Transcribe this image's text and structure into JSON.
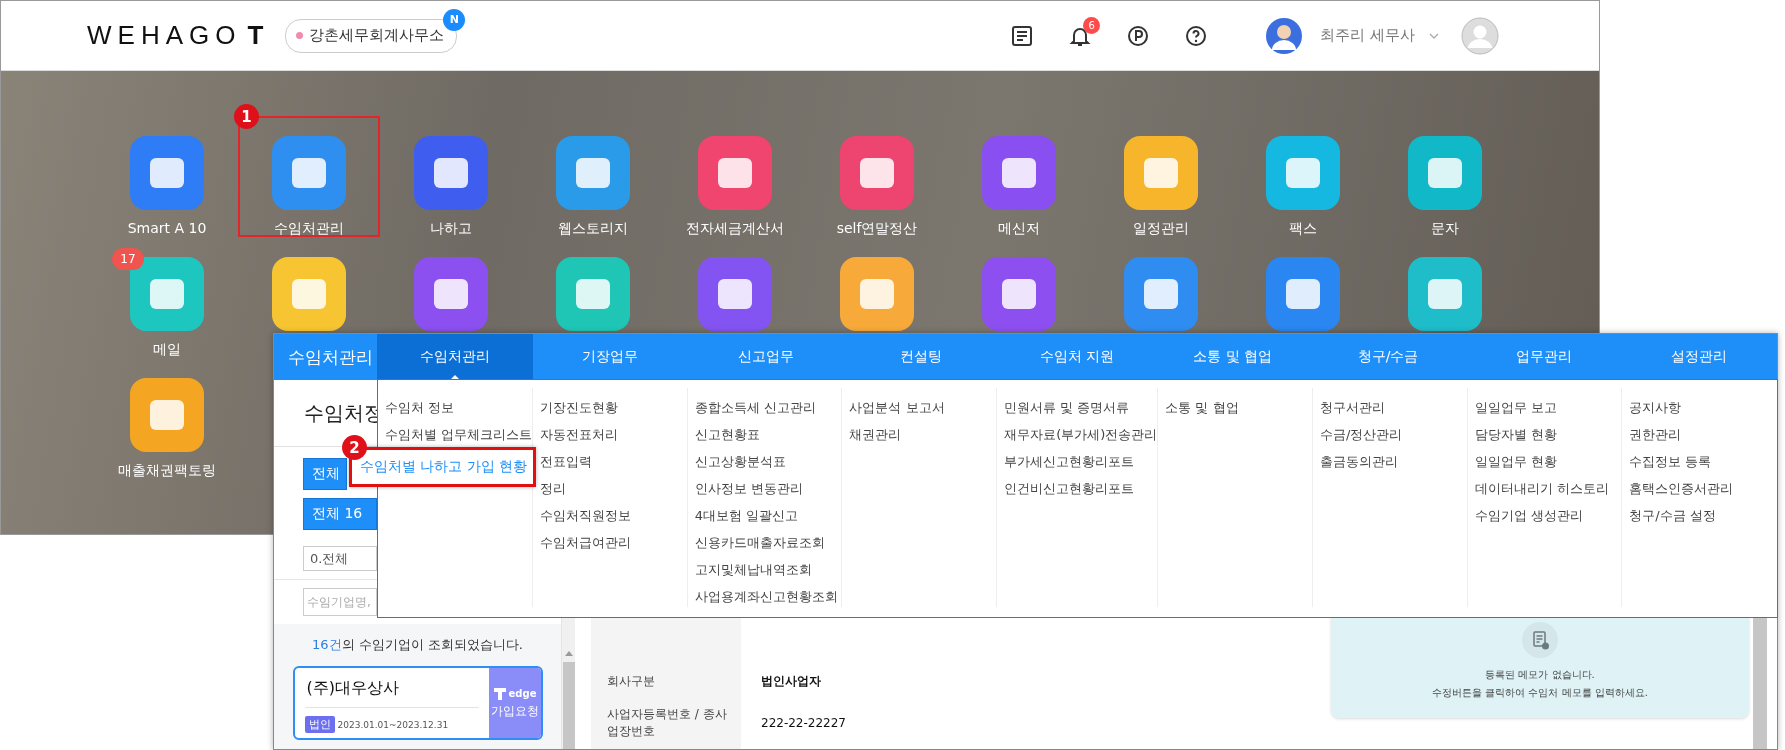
{
  "topbar": {
    "logo": "WEHAGO",
    "logo_suffix": "T",
    "company": {
      "name": "강촌세무회계사무소",
      "badge": "N"
    },
    "notification_badge": "6",
    "user_name": "최주리 세무사"
  },
  "apps": [
    {
      "label": "Smart A 10",
      "color": "#2f7df6"
    },
    {
      "label": "수임처관리",
      "color": "#2e8ff0",
      "highlighted": true,
      "callout": "1"
    },
    {
      "label": "나하고",
      "color": "#3f5ef0"
    },
    {
      "label": "웹스토리지",
      "color": "#2a9be8"
    },
    {
      "label": "전자세금계산서",
      "color": "#f0456e"
    },
    {
      "label": "self연말정산",
      "color": "#ee4470"
    },
    {
      "label": "메신저",
      "color": "#8a4ff0"
    },
    {
      "label": "일정관리",
      "color": "#f7b52c"
    },
    {
      "label": "팩스",
      "color": "#14b8e0"
    },
    {
      "label": "문자",
      "color": "#10b8c8"
    },
    {
      "label": "메일",
      "color": "#1ec6c0",
      "badge": "17"
    },
    {
      "color": "#f7c531"
    },
    {
      "color": "#8c4ff0"
    },
    {
      "color": "#1fc6b5"
    },
    {
      "color": "#8454f2"
    },
    {
      "color": "#f7a93a"
    },
    {
      "color": "#8e4ff0"
    },
    {
      "color": "#2f8df2"
    },
    {
      "color": "#2a86f0"
    },
    {
      "color": "#1fbcc9"
    },
    {
      "label": "매출채권팩토링",
      "color": "#f4a623"
    }
  ],
  "window": {
    "title": "수임처관리",
    "tabs": [
      {
        "label": "수임처관리",
        "selected": true,
        "items": [
          "수임처 정보",
          "수임처별 업무체크리스트"
        ]
      },
      {
        "label": "기장업무",
        "selected": false,
        "items": [
          "기장진도현황",
          "자동전표처리",
          "전표입력",
          "정리",
          "수임처직원정보",
          "수임처급여관리"
        ]
      },
      {
        "label": "신고업무",
        "selected": false,
        "items": [
          "종합소득세 신고관리",
          "신고현황표",
          "신고상황분석표",
          "인사정보 변동관리",
          "4대보험 일괄신고",
          "신용카드매출자료조회",
          "고지및체납내역조회",
          "사업용계좌신고현황조회"
        ]
      },
      {
        "label": "컨설팅",
        "selected": false,
        "items": [
          "사업분석 보고서",
          "채권관리"
        ]
      },
      {
        "label": "수임처 지원",
        "selected": false,
        "items": [
          "민원서류 및 증명서류",
          "재무자료(부가세)전송관리",
          "부가세신고현황리포트",
          "인건비신고현황리포트"
        ]
      },
      {
        "label": "소통 및 협업",
        "selected": false,
        "items": [
          "소통 및 협업"
        ]
      },
      {
        "label": "청구/수금",
        "selected": false,
        "items": [
          "청구서관리",
          "수금/정산관리",
          "출금동의관리"
        ]
      },
      {
        "label": "업무관리",
        "selected": false,
        "items": [
          "일일업무 보고",
          "담당자별 현황",
          "일일업무 현황",
          "데이터내리기 히스토리",
          "수임기업 생성관리"
        ]
      },
      {
        "label": "설정관리",
        "selected": false,
        "items": [
          "공지사항",
          "권한관리",
          "수집정보 등록",
          "홈택스인증서관리",
          "청구/수금 설정"
        ]
      }
    ],
    "panel": {
      "title": "수임처정",
      "filter_buttons": [
        "전체",
        "전체 16"
      ],
      "select_value": "0.전체",
      "search_placeholder": "수임기업명,",
      "result_count": "16건",
      "result_text": "의 수임기업이 조회되었습니다.",
      "card": {
        "name": "(주)대우상사",
        "tag": "법인",
        "period": "2023.01.01~2023.12.31",
        "brand": "edge",
        "action": "가입요청"
      }
    },
    "details": [
      {
        "label": "회사구분",
        "value": "법인사업자"
      },
      {
        "label": "사업자등록번호 / 종사업장번호",
        "value": "222-22-22227"
      }
    ],
    "memo": {
      "lines": [
        "등록된 메모가 없습니다.",
        "수정버튼을 클릭하여 수임처 메모를 입력하세요."
      ]
    },
    "callout": {
      "number": "2",
      "text": "수임처별 나하고 가입 현황"
    }
  }
}
